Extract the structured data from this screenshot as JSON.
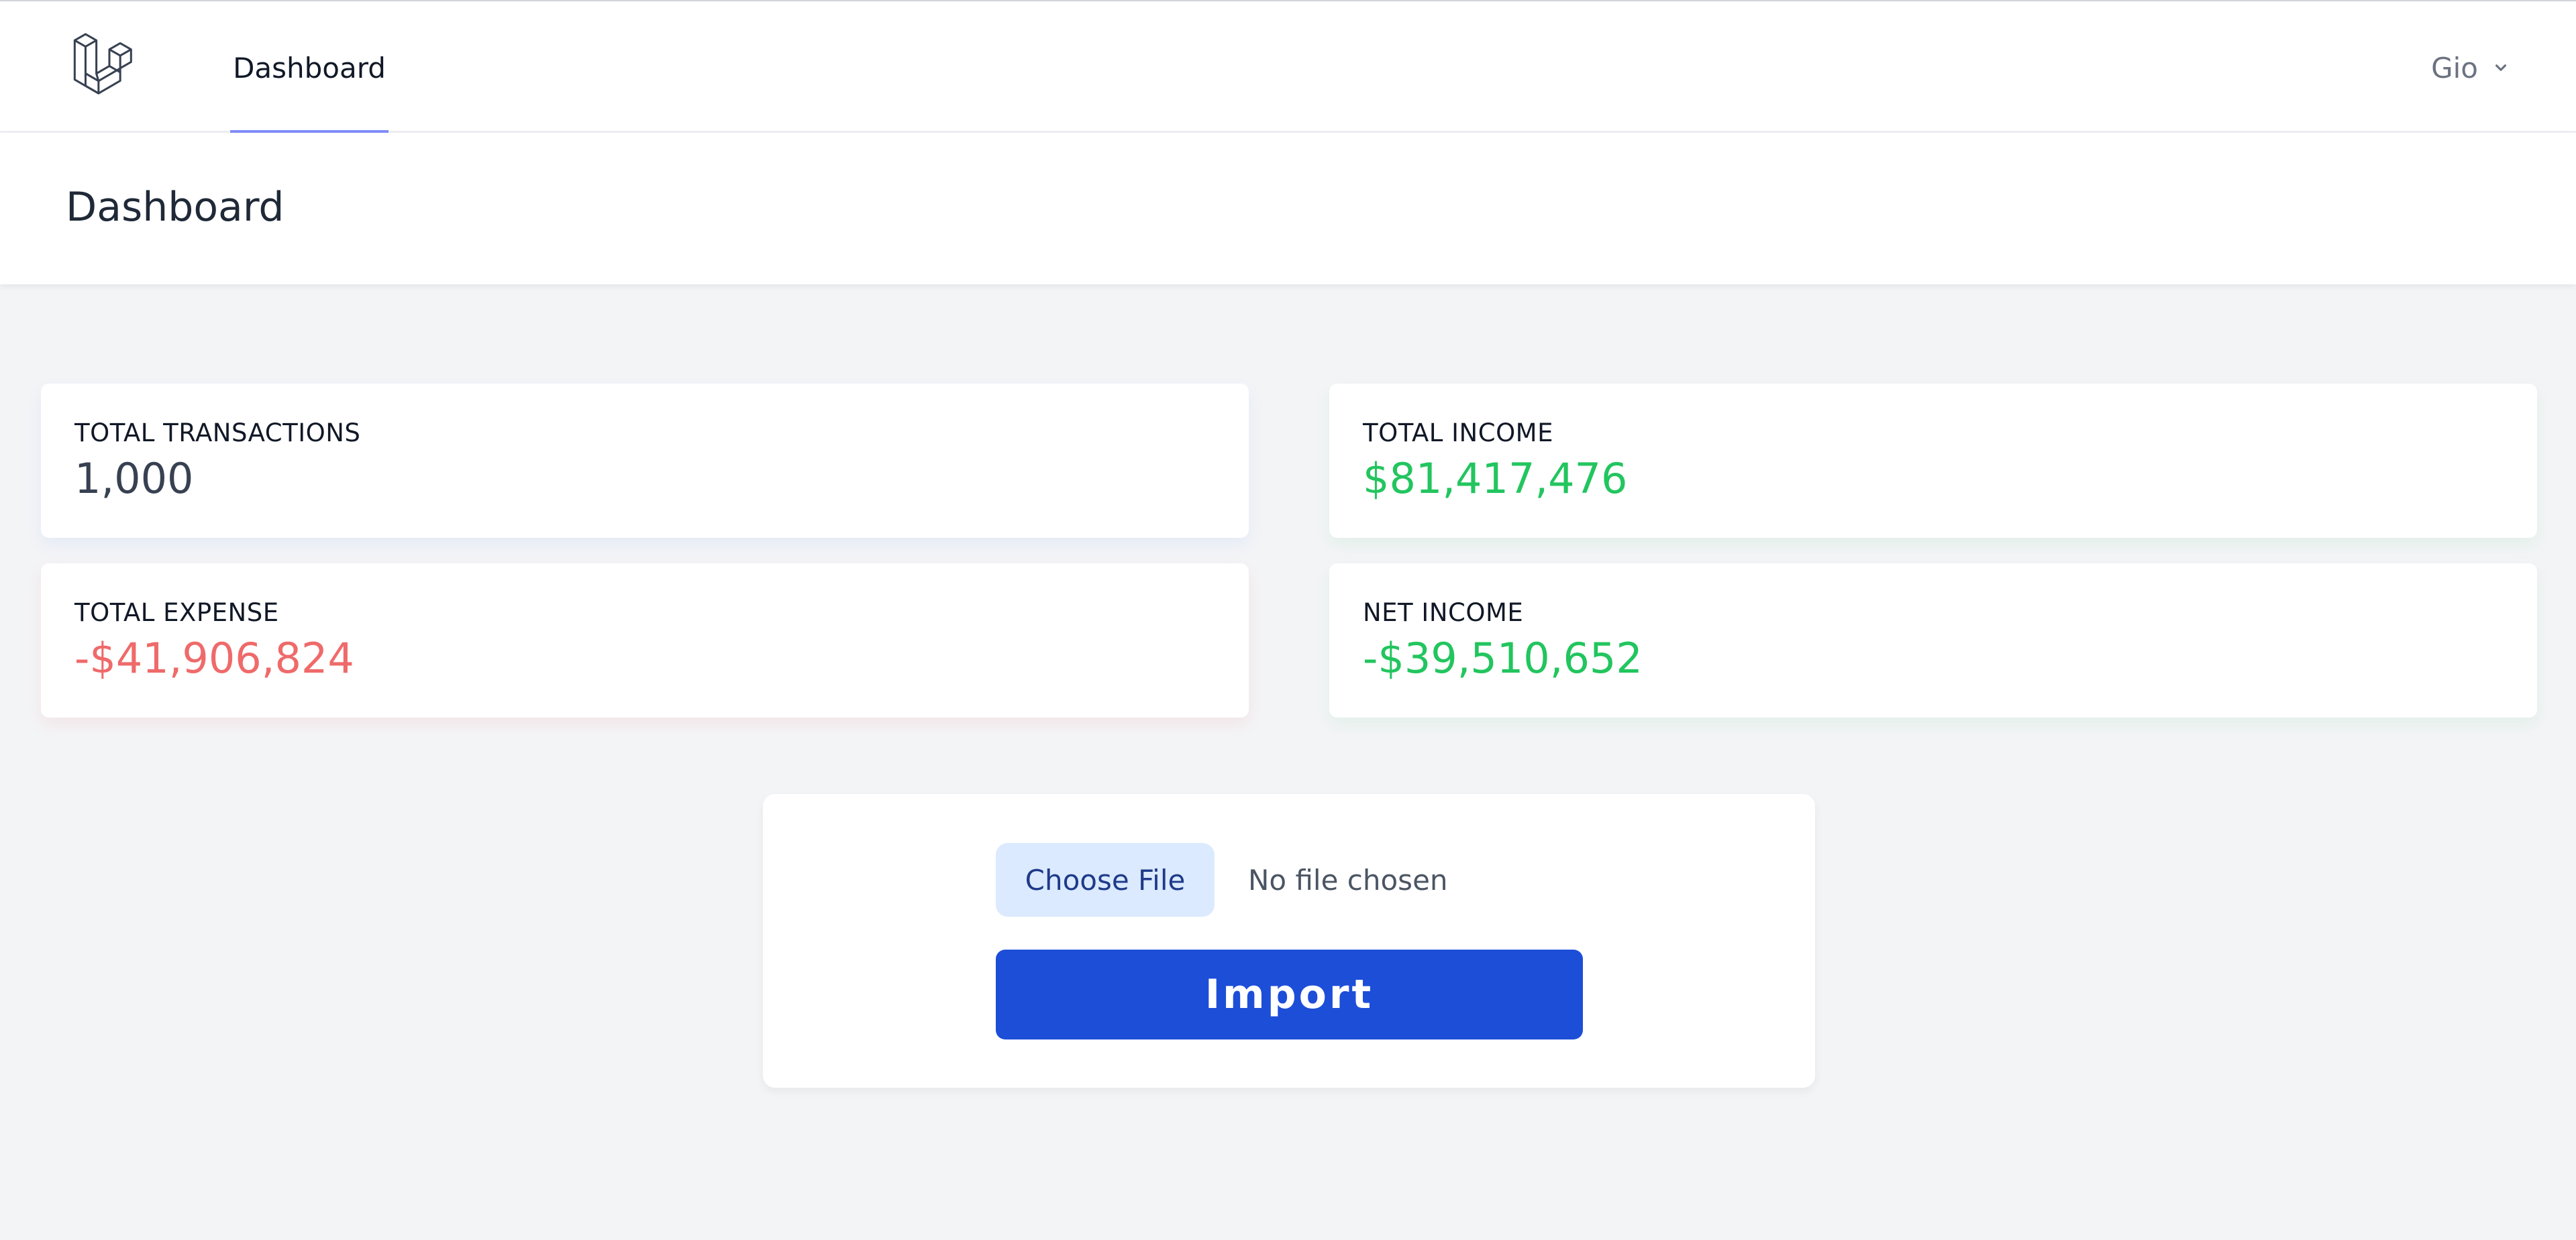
{
  "nav": {
    "logo_icon": "laravel-logo-icon",
    "dashboard_link": "Dashboard",
    "user_name": "Gio",
    "user_menu_icon": "chevron-down-icon",
    "active_underline_color": "#818cf8"
  },
  "header": {
    "title": "Dashboard"
  },
  "stats": {
    "total_transactions": {
      "label": "TOTAL TRANSACTIONS",
      "value": "1,000",
      "color": "#374151"
    },
    "total_income": {
      "label": "TOTAL INCOME",
      "value": "$81,417,476",
      "color": "#22c55e"
    },
    "total_expense": {
      "label": "TOTAL EXPENSE",
      "value": "-$41,906,824",
      "color": "#ef6a6a"
    },
    "net_income": {
      "label": "NET INCOME",
      "value": "-$39,510,652",
      "color": "#22c55e"
    }
  },
  "import": {
    "choose_file_label": "Choose File",
    "no_file_text": "No file chosen",
    "import_button_label": "Import",
    "import_button_color": "#1d4ed8"
  }
}
